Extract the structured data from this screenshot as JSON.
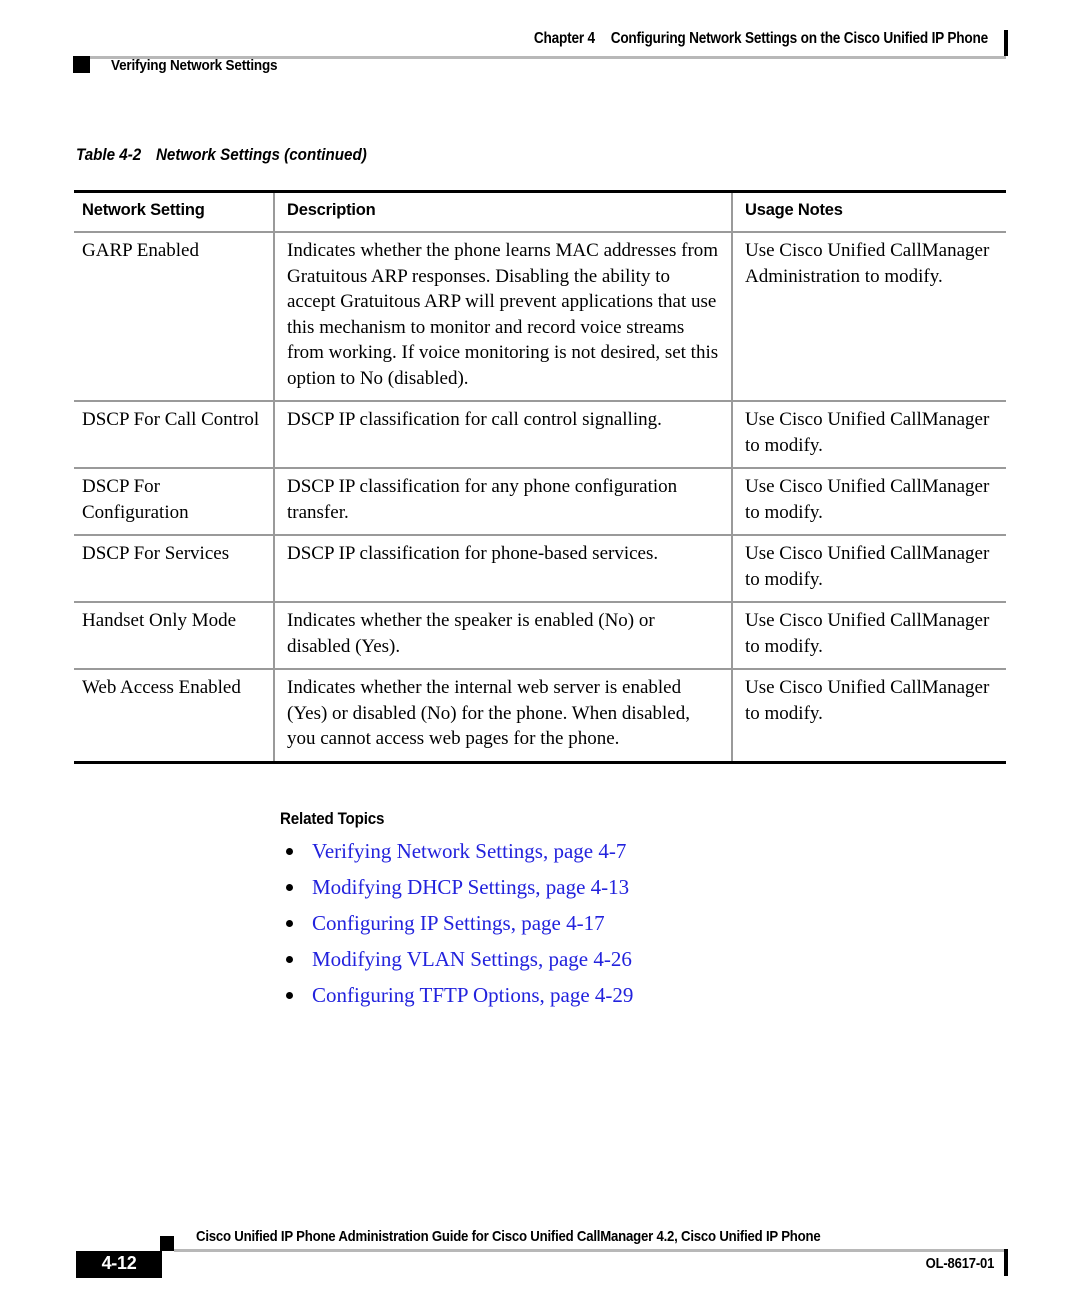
{
  "header": {
    "chapter_label": "Chapter 4",
    "chapter_title": "Configuring Network Settings on the Cisco Unified IP Phone",
    "section_title": "Verifying Network Settings"
  },
  "table": {
    "caption_number": "Table 4-2",
    "caption_title": "Network Settings (continued)",
    "columns": [
      "Network Setting",
      "Description",
      "Usage Notes"
    ],
    "rows": [
      {
        "setting": "GARP Enabled",
        "description": "Indicates whether the phone learns MAC addresses from Gratuitous ARP responses. Disabling the ability to accept Gratuitous ARP will prevent applications that use this mechanism to monitor and record voice streams from working. If voice monitoring is not desired, set this option to No (disabled).",
        "usage_notes": "Use Cisco Unified CallManager Administration to modify."
      },
      {
        "setting": "DSCP For Call Control",
        "description": "DSCP IP classification for call control signalling.",
        "usage_notes": "Use Cisco Unified CallManager to modify."
      },
      {
        "setting": "DSCP For Configuration",
        "description": "DSCP IP classification for any phone configuration transfer.",
        "usage_notes": "Use Cisco Unified CallManager to modify."
      },
      {
        "setting": "DSCP For Services",
        "description": "DSCP IP classification for phone-based services.",
        "usage_notes": "Use Cisco Unified CallManager to modify."
      },
      {
        "setting": "Handset Only Mode",
        "description": "Indicates whether the speaker is enabled (No) or disabled (Yes).",
        "usage_notes": "Use Cisco Unified CallManager to modify."
      },
      {
        "setting": "Web Access Enabled",
        "description": "Indicates whether the internal web server is enabled (Yes) or disabled (No) for the phone. When disabled, you cannot access web pages for the phone.",
        "usage_notes": "Use Cisco Unified CallManager to modify."
      }
    ]
  },
  "related_topics": {
    "heading": "Related Topics",
    "link_color": "#2222dd",
    "items": [
      "Verifying Network Settings, page 4-7",
      "Modifying DHCP Settings, page 4-13",
      "Configuring IP Settings, page 4-17",
      "Modifying VLAN Settings, page 4-26",
      "Configuring TFTP Options, page 4-29"
    ]
  },
  "footer": {
    "page_number": "4-12",
    "guide_title": "Cisco Unified IP Phone Administration Guide for Cisco Unified CallManager 4.2, Cisco Unified IP Phone",
    "doc_id": "OL-8617-01"
  }
}
